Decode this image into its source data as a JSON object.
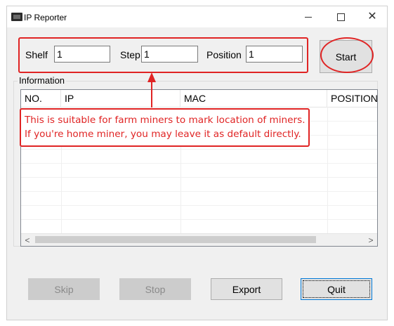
{
  "window": {
    "title": "IP Reporter",
    "controls": {
      "minimize": "minimize-icon",
      "maximize": "maximize-icon",
      "close": "close-icon"
    }
  },
  "fields": {
    "shelf": {
      "label": "Shelf",
      "value": "1"
    },
    "step": {
      "label": "Step",
      "value": "1"
    },
    "position": {
      "label": "Position",
      "value": "1"
    }
  },
  "buttons": {
    "start": "Start",
    "skip": "Skip",
    "stop": "Stop",
    "export": "Export",
    "quit": "Quit"
  },
  "information": {
    "title": "Information",
    "columns": [
      "NO.",
      "IP",
      "MAC",
      "POSITION"
    ],
    "rows": []
  },
  "annotation": {
    "note_line_1": "This is suitable for farm miners to mark location of miners.",
    "note_line_2": "If you're home miner, you may leave it as default directly.",
    "color": "#e02424"
  }
}
